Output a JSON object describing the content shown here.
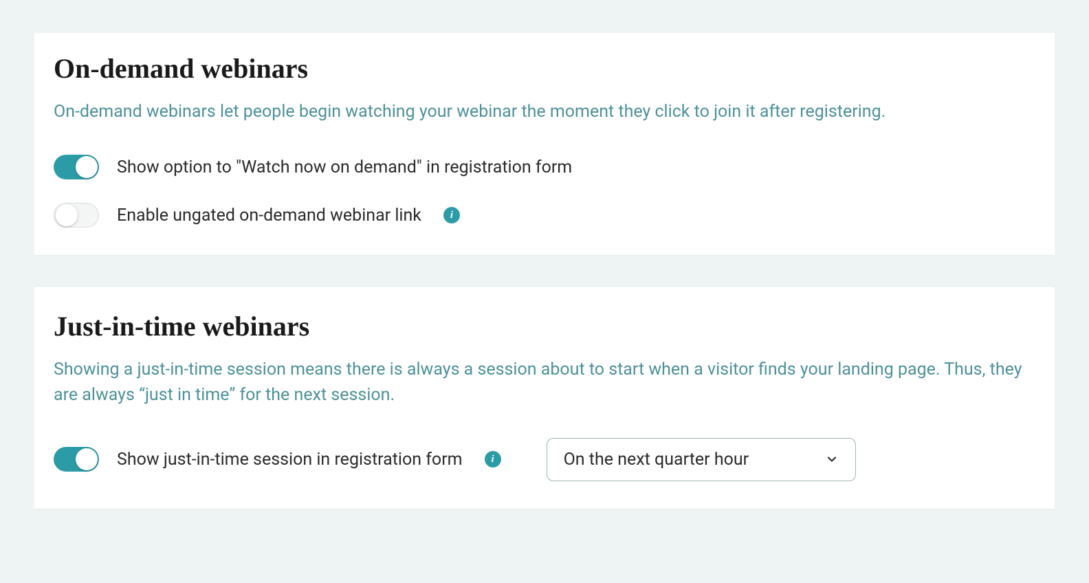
{
  "sections": {
    "on_demand": {
      "title": "On-demand webinars",
      "description": "On-demand webinars let people begin watching your webinar the moment they click to join it after registering.",
      "options": {
        "show_watch_now": {
          "label": "Show option to \"Watch now on demand\" in registration form",
          "enabled": true
        },
        "ungated_link": {
          "label": "Enable ungated on-demand webinar link",
          "enabled": false
        }
      }
    },
    "just_in_time": {
      "title": "Just-in-time webinars",
      "description": "Showing a just-in-time session means there is always a session about to start when a visitor finds your landing page. Thus, they are always “just in time” for the next session.",
      "options": {
        "show_jit": {
          "label": "Show just-in-time session in registration form",
          "enabled": true,
          "timing_selected": "On the next quarter hour"
        }
      }
    }
  },
  "colors": {
    "accent": "#2b9ca6",
    "muted_text": "#4d9198"
  },
  "info_glyph": "i"
}
